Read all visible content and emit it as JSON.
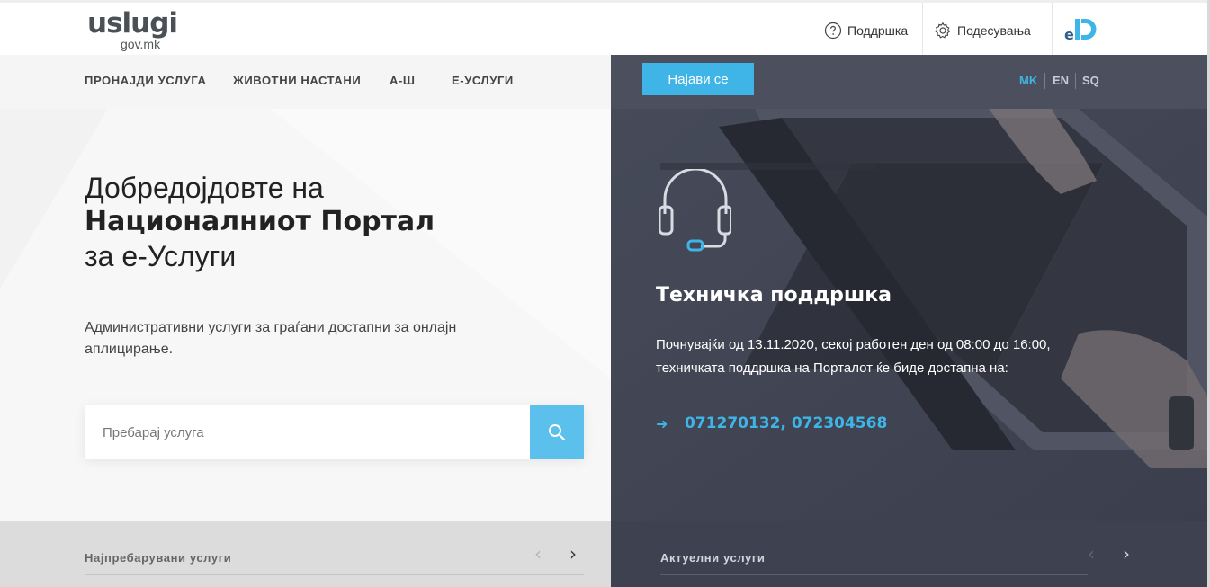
{
  "header": {
    "logo_main": "uslugi",
    "logo_sub": "gov.mk",
    "support_label": "Поддршка",
    "settings_label": "Подесувања",
    "eid_label": "eID"
  },
  "nav": {
    "items": [
      "ПРОНАЈДИ УСЛУГА",
      "ЖИВОТНИ НАСТАНИ",
      "А-Ш",
      "Е-УСЛУГИ"
    ],
    "login_label": "Најави се",
    "languages": [
      "MK",
      "EN",
      "SQ"
    ],
    "active_language": "MK"
  },
  "hero": {
    "welcome_line1": "Добредојдовте на",
    "welcome_line2": "Националниот Портал",
    "welcome_line3": "за е-Услуги",
    "subtitle": "Административни услуги за граѓани достапни за онлајн аплицирање.",
    "search_placeholder": "Пребарај услуга"
  },
  "support": {
    "title": "Техничка поддршка",
    "text": "Почнувајќи од 13.11.2020, секој работен ден од 08:00 до 16:00, техничката поддршка на Порталот ќе биде достапна на:",
    "phones": "071270132, 072304568"
  },
  "sections": {
    "left_title": "Најпребарувани услуги",
    "right_title": "Актуелни услуги",
    "prev_arrow": "‹",
    "next_arrow": "›"
  },
  "colors": {
    "accent": "#3fb4e6",
    "dark_panel": "#3e4250"
  }
}
